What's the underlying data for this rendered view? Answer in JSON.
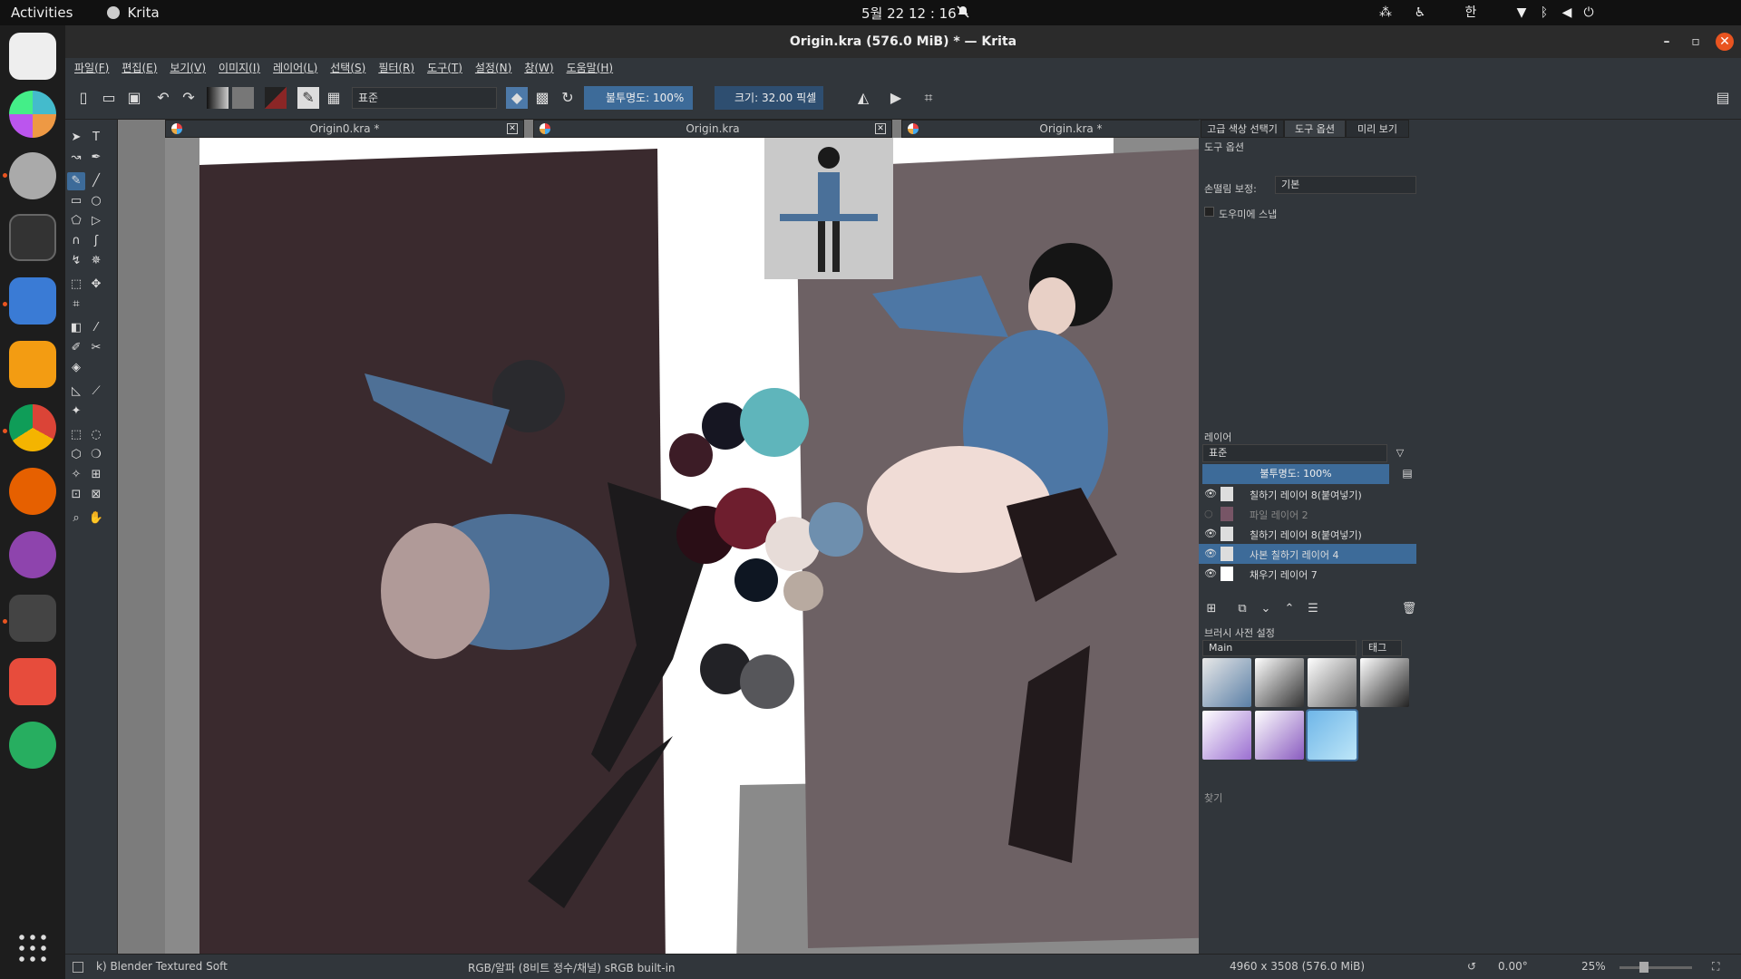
{
  "topbar": {
    "activities": "Activities",
    "app_name": "Krita",
    "clock": "5월 22  12 : 16",
    "input_method": "한"
  },
  "window": {
    "title": "Origin.kra (576.0 MiB)  * — Krita"
  },
  "menu": {
    "items": [
      "파일(F)",
      "편집(E)",
      "보기(V)",
      "이미지(I)",
      "레이어(L)",
      "선택(S)",
      "필터(R)",
      "도구(T)",
      "설정(N)",
      "창(W)",
      "도움말(H)"
    ]
  },
  "toolbar": {
    "blend_mode": "표준",
    "opacity": "불투명도: 100%",
    "size": "크기: 32.00 픽셀"
  },
  "doc_tabs": [
    {
      "label": "Origin0.kra *"
    },
    {
      "label": "Origin.kra"
    },
    {
      "label": "Origin.kra *"
    }
  ],
  "right_panel": {
    "tabs": [
      "고급 색상 선택기",
      "도구 옵션",
      "미리 보기"
    ],
    "tool_options_title": "도구 옵션",
    "smoothing_label": "손떨림 보정:",
    "smoothing_value": "기본",
    "snap_label": "도우미에 스냅",
    "layers_title": "레이어",
    "layer_blend": "표준",
    "layer_opacity": "불투명도: 100%",
    "layers": [
      {
        "name": "칠하기 레이어 8(붙여넣기)",
        "visible": true
      },
      {
        "name": "파일 레이어 2",
        "visible": false
      },
      {
        "name": "칠하기 레이어 8(붙여넣기)",
        "visible": true
      },
      {
        "name": "사본 칠하기 레이어 4",
        "visible": true,
        "selected": true
      },
      {
        "name": "채우기 레이어 7",
        "visible": true
      }
    ],
    "brush_title": "브러시 사전 설정",
    "brush_set": "Main",
    "brush_tag": "태그",
    "search_placeholder": "찾기"
  },
  "status": {
    "brush": "k) Blender Textured Soft",
    "color": "RGB/알파 (8비트 정수/채널)  sRGB built-in",
    "dimensions": "4960 x 3508 (576.0 MiB)",
    "rotation": "0.00°",
    "zoom": "25%"
  }
}
